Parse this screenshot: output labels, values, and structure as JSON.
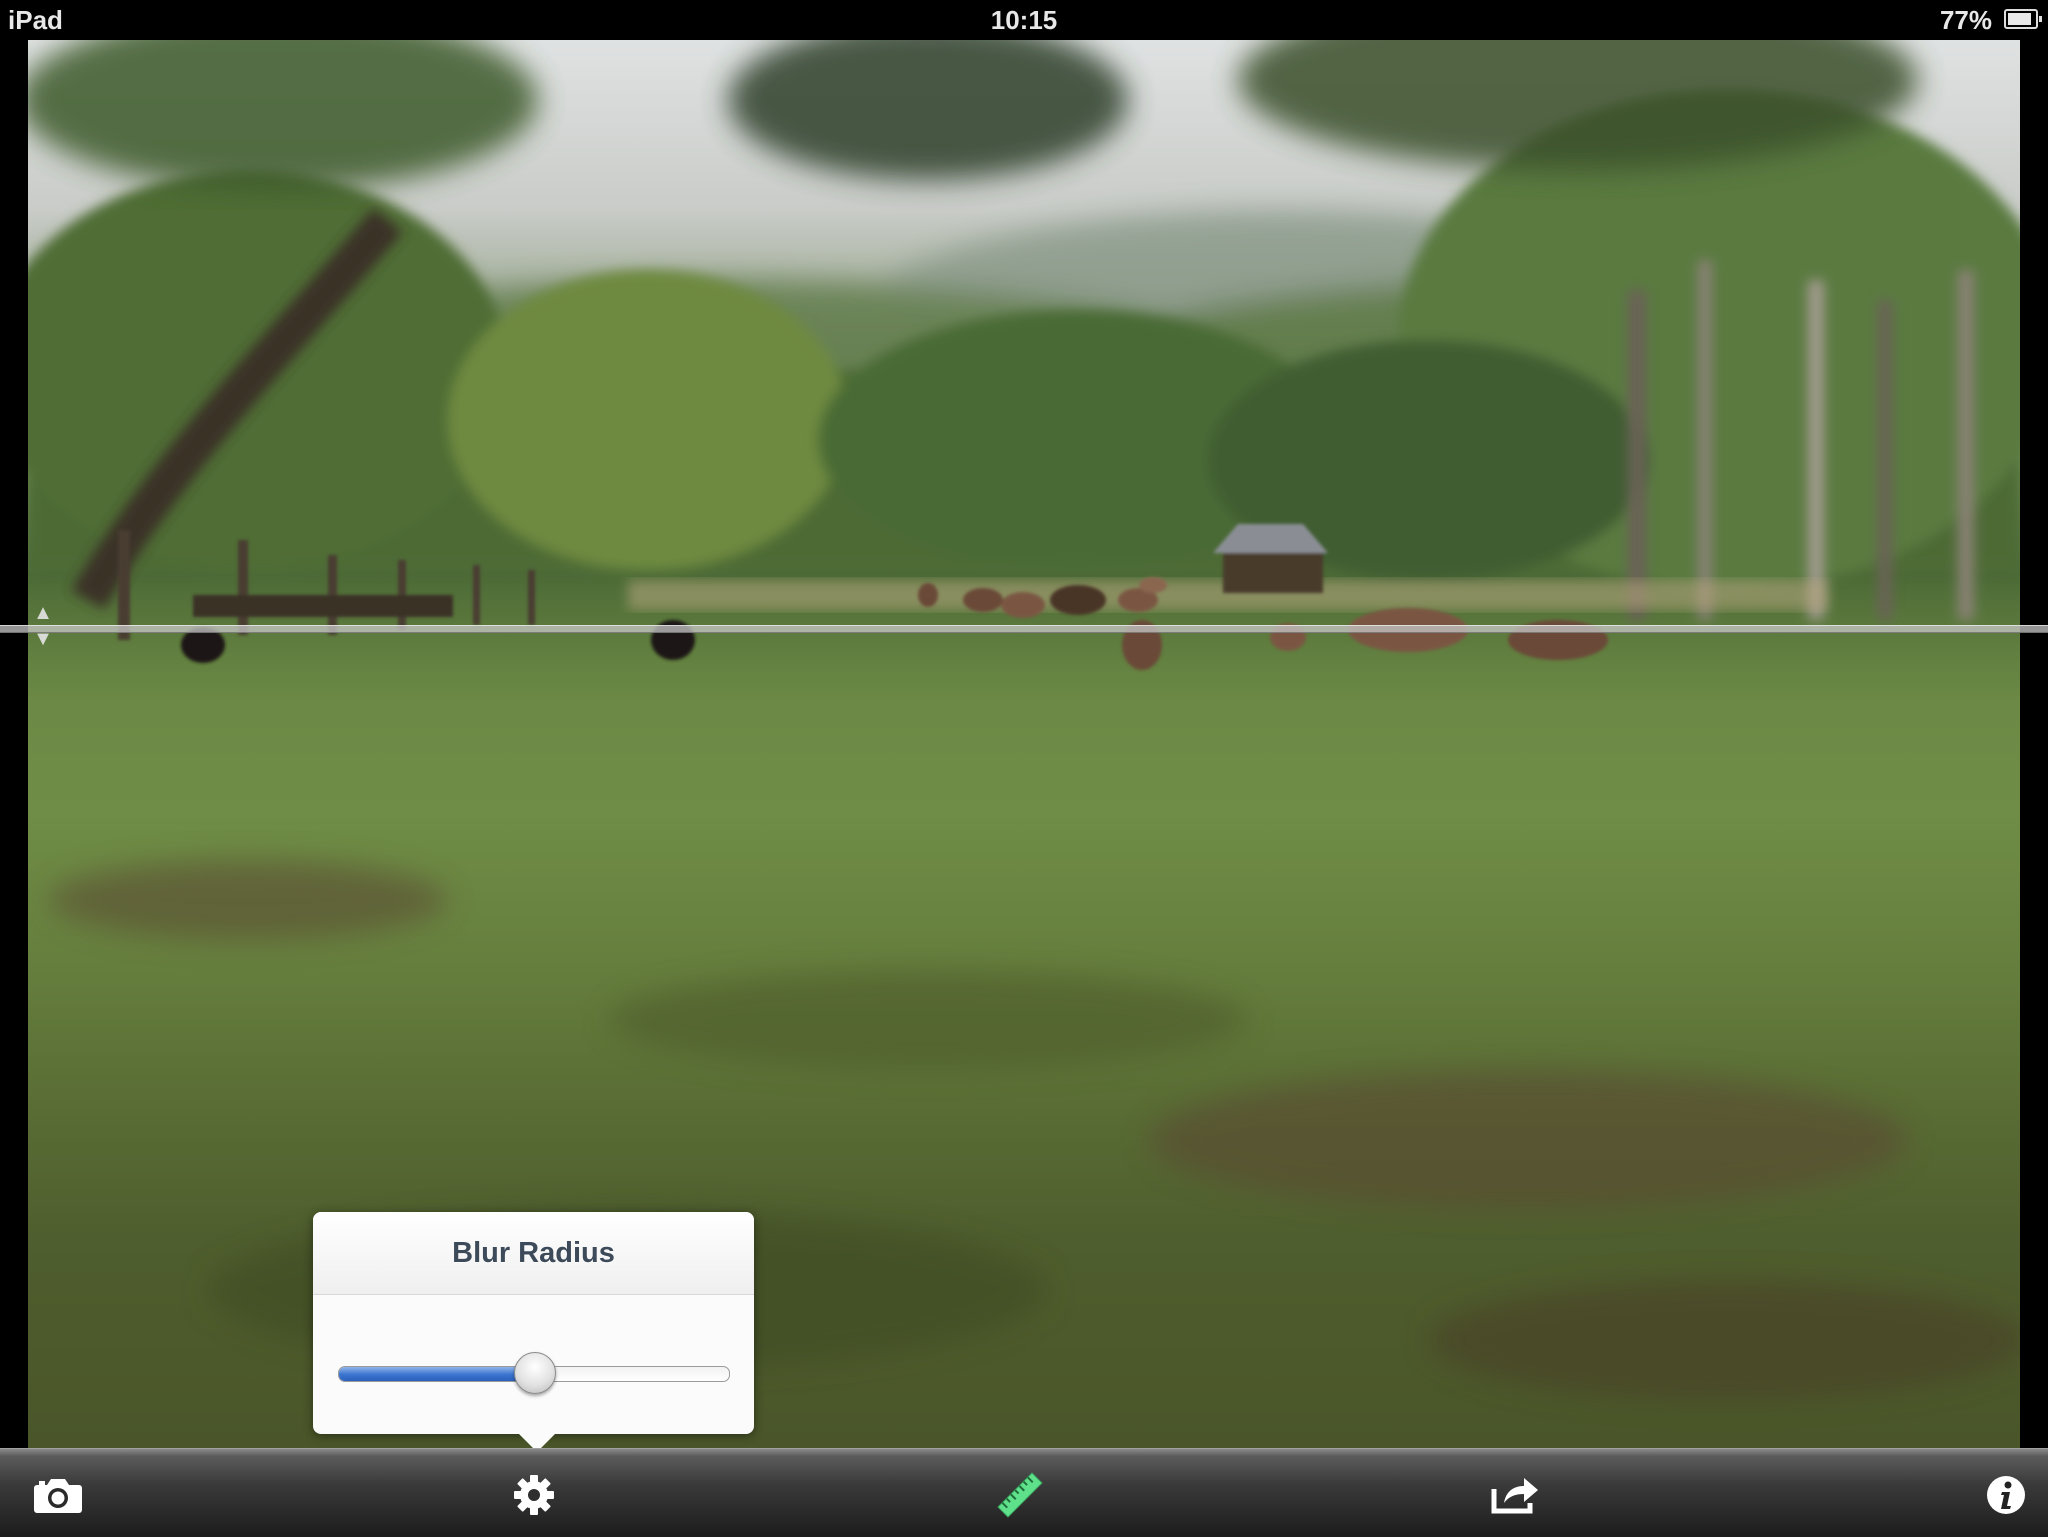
{
  "status_bar": {
    "carrier": "iPad",
    "time": "10:15",
    "battery_text": "77%",
    "battery_level": 0.77
  },
  "popover": {
    "title": "Blur Radius",
    "slider_value": 0.5
  },
  "toolbar": {
    "items": [
      {
        "icon": "camera-icon"
      },
      {
        "icon": "gear-icon"
      },
      {
        "icon": "ruler-icon",
        "color": "#5fe08a"
      },
      {
        "icon": "share-icon"
      },
      {
        "icon": "info-icon"
      }
    ]
  },
  "colors": {
    "slider_fill": "#3a74d0",
    "ruler_active": "#5fe08a"
  }
}
